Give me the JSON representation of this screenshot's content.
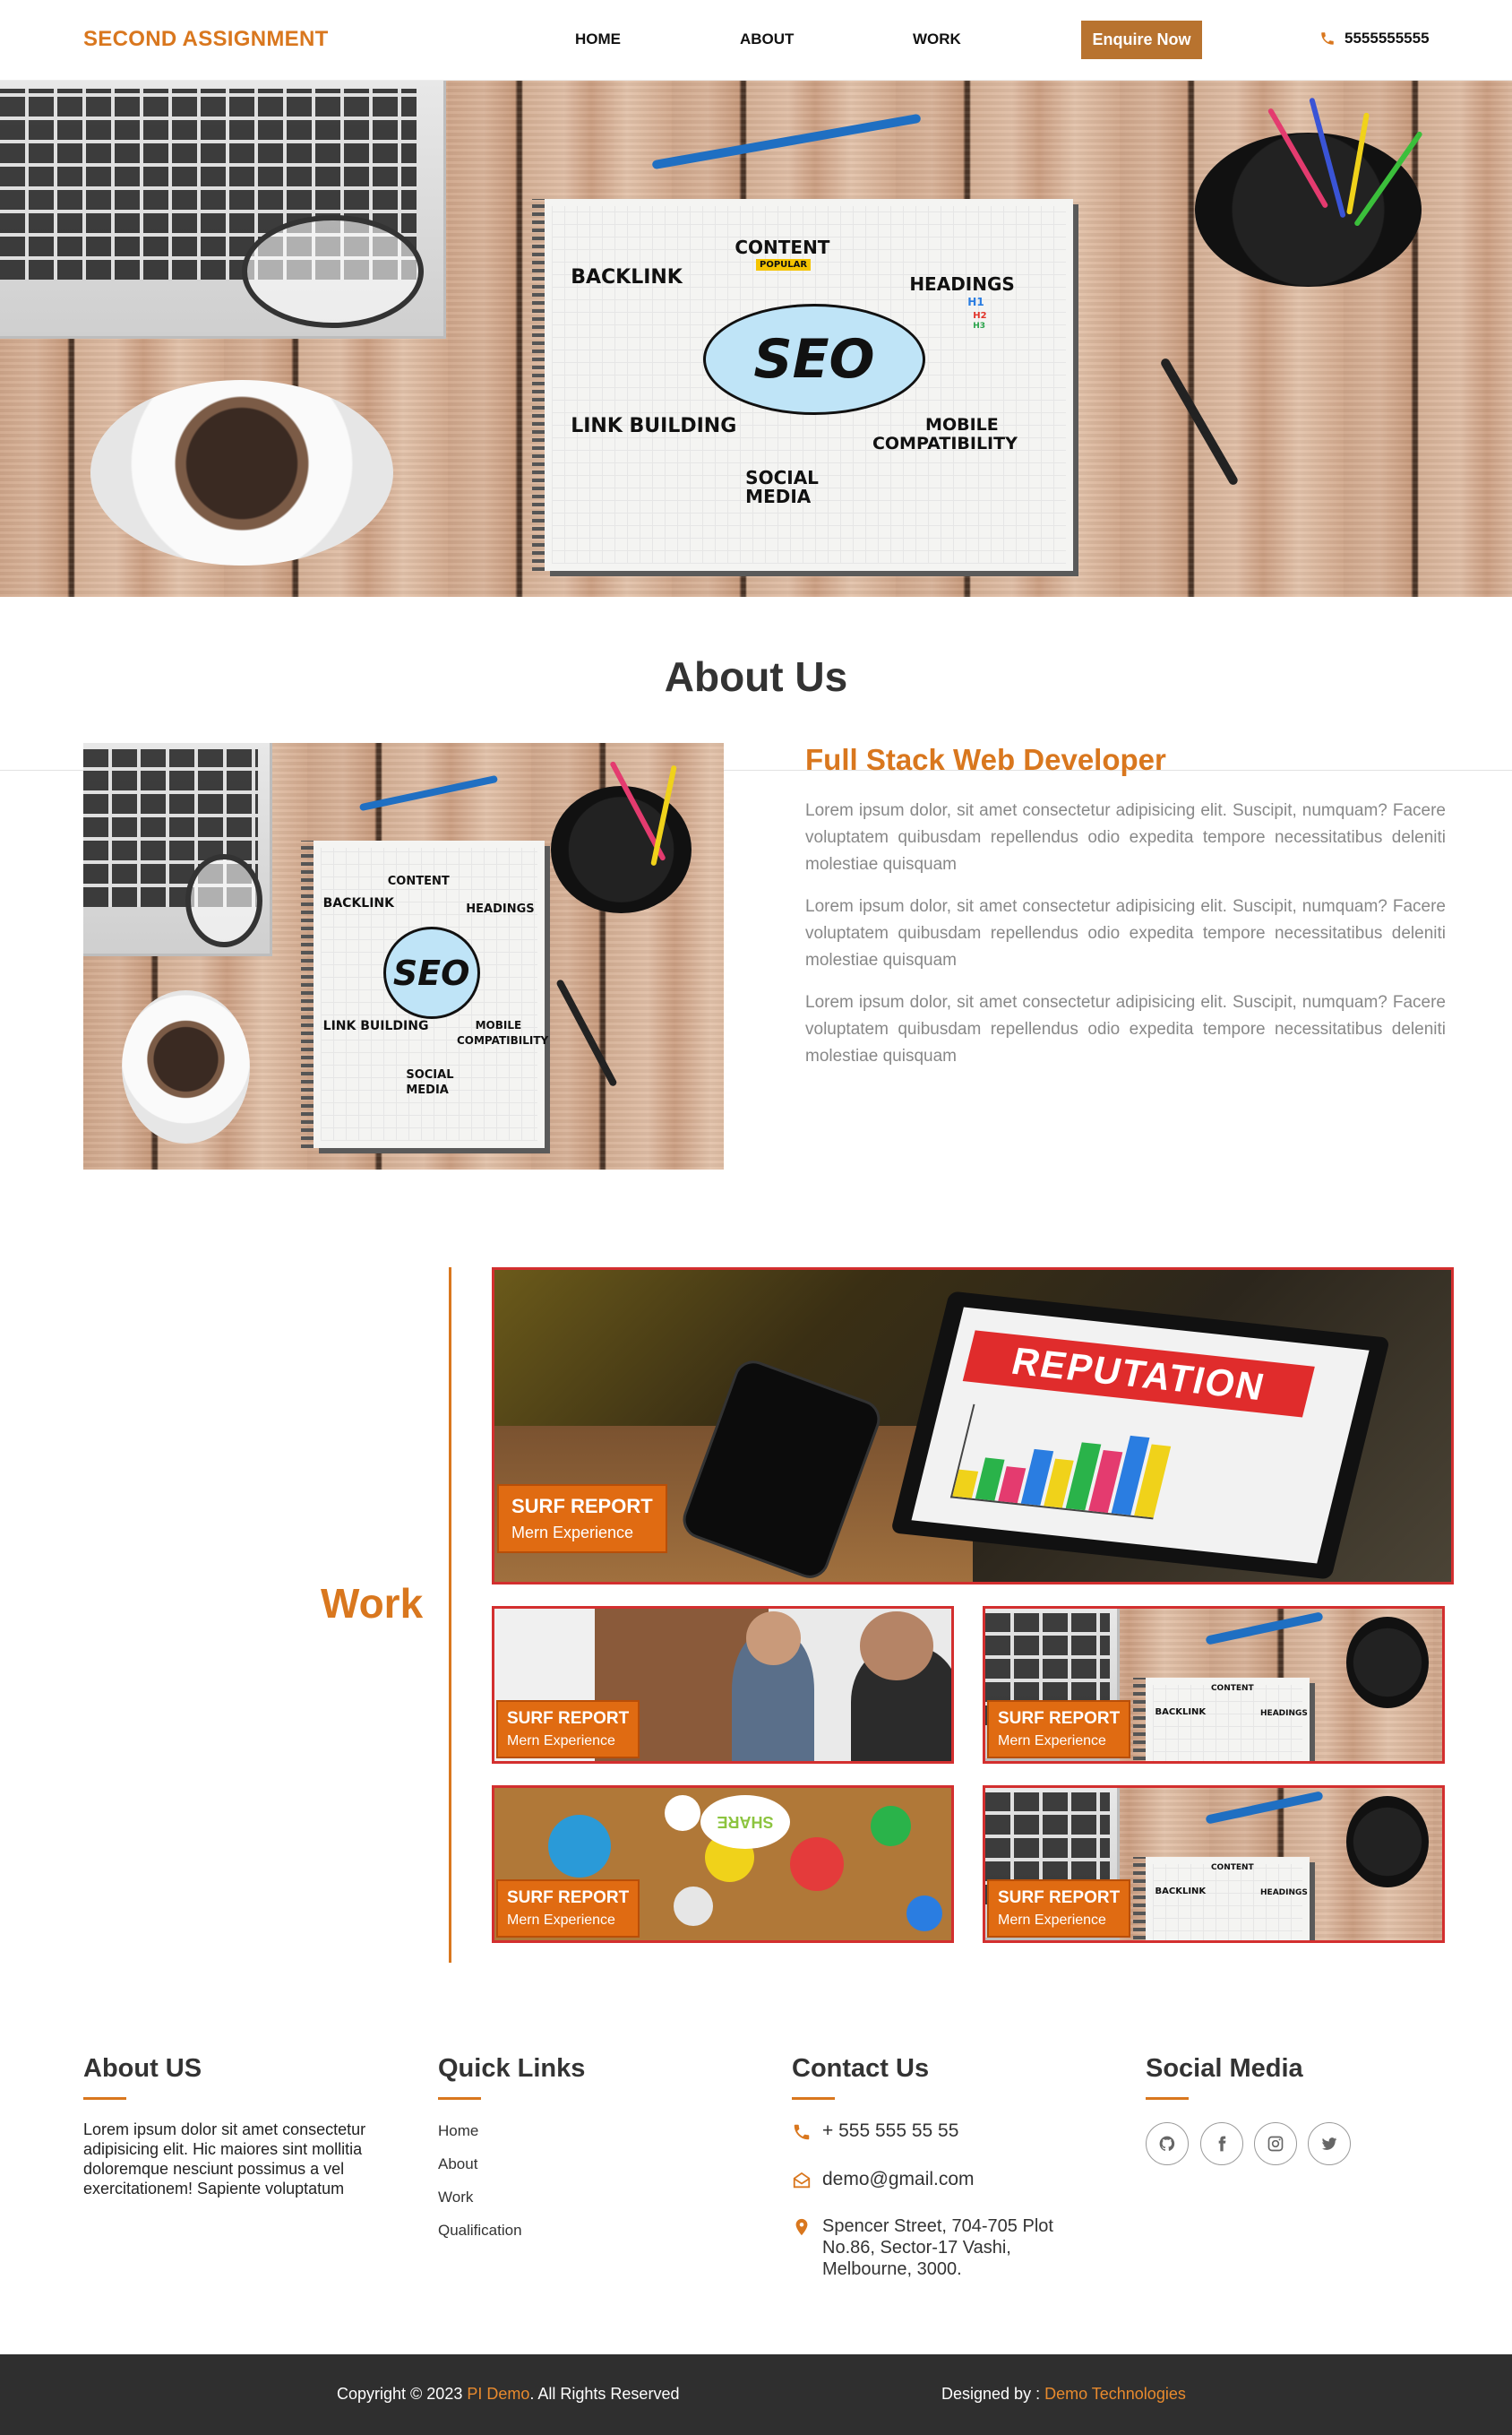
{
  "nav": {
    "brand": "SECOND ASSIGNMENT",
    "links": [
      "HOME",
      "ABOUT",
      "WORK"
    ],
    "enquire": "Enquire Now",
    "phone": "5555555555",
    "accent": "#d9771e"
  },
  "hero": {
    "words": {
      "content": "CONTENT",
      "popular": "POPULAR",
      "backlink": "BACKLINK",
      "headings": "HEADINGS",
      "h1": "H1",
      "h2": "H2",
      "h3": "H3",
      "seo": "SEO",
      "link_building": "LINK BUILDING",
      "mobile": "MOBILE",
      "compat": "COMPATIBILITY",
      "social": "SOCIAL",
      "media": "MEDIA"
    }
  },
  "about": {
    "title": "About Us",
    "subtitle": "Full Stack Web Developer",
    "paragraphs": [
      "Lorem ipsum dolor, sit amet consectetur adipisicing elit. Suscipit, numquam? Facere voluptatem quibusdam repellendus odio expedita tempore necessitatibus deleniti molestiae quisquam",
      "Lorem ipsum dolor, sit amet consectetur adipisicing elit. Suscipit, numquam? Facere voluptatem quibusdam repellendus odio expedita tempore necessitatibus deleniti molestiae quisquam",
      "Lorem ipsum dolor, sit amet consectetur adipisicing elit. Suscipit, numquam? Facere voluptatem quibusdam repellendus odio expedita tempore necessitatibus deleniti molestiae quisquam"
    ]
  },
  "work": {
    "title": "Work",
    "big_card_screen": "REPUTATION",
    "cards": [
      {
        "title": "SURF REPORT",
        "sub": "Mern Experience"
      },
      {
        "title": "SURF REPORT",
        "sub": "Mern Experience"
      },
      {
        "title": "SURF REPORT",
        "sub": "Mern Experience"
      },
      {
        "title": "SURF REPORT",
        "sub": "Mern Experience"
      },
      {
        "title": "SURF REPORT",
        "sub": "Mern Experience"
      }
    ],
    "share_label": "SHARE"
  },
  "footer": {
    "about_title": "About US",
    "about_text": "Lorem ipsum dolor sit amet consectetur adipisicing elit. Hic maiores sint mollitia doloremque nesciunt possimus a vel exercitationem! Sapiente voluptatum",
    "links_title": "Quick Links",
    "links": [
      "Home",
      "About",
      "Work",
      "Qualification"
    ],
    "contact_title": "Contact Us",
    "phone": "+ 555 555 55 55",
    "email": "demo@gmail.com",
    "address": "Spencer Street, 704-705 Plot No.86, Sector-17 Vashi, Melbourne, 3000.",
    "social_title": "Social Media",
    "social_icons": [
      "github-icon",
      "facebook-icon",
      "instagram-icon",
      "twitter-icon"
    ]
  },
  "copyright": {
    "prefix": "Copyright © 2023 ",
    "brand": "PI Demo",
    "suffix": ". All Rights Reserved",
    "designed_prefix": "Designed by : ",
    "designer": "Demo Technologies"
  }
}
